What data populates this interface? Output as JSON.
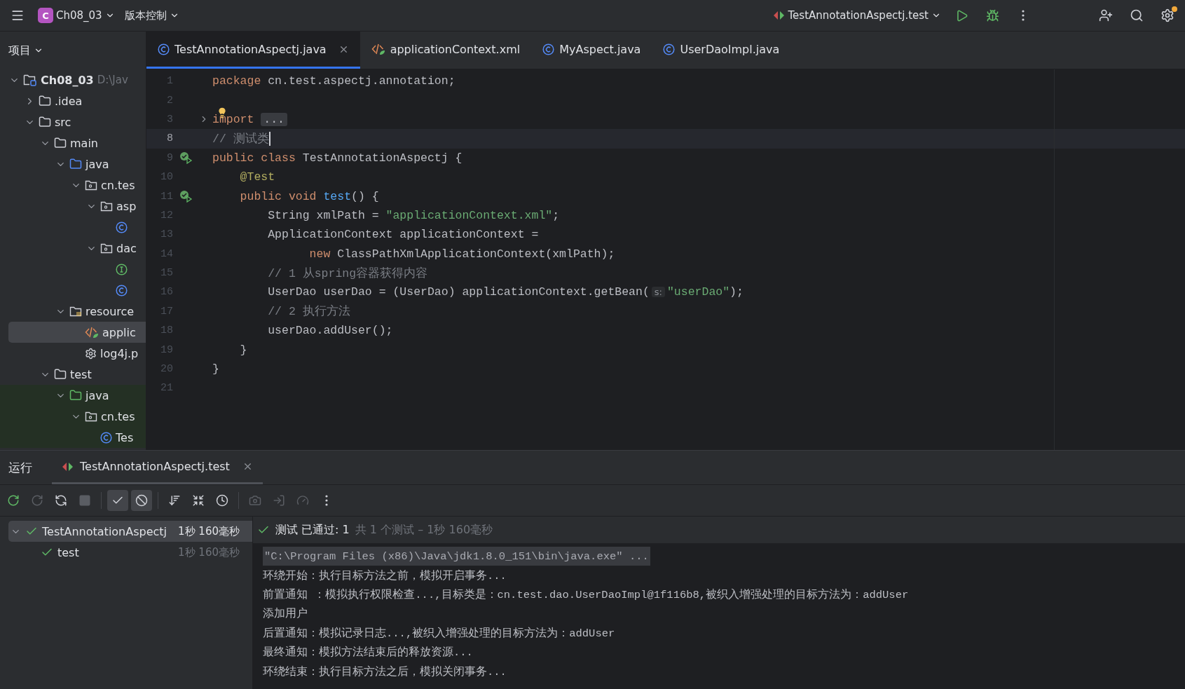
{
  "title_bar": {
    "project_badge": "C",
    "project": "Ch08_03",
    "vcs": "版本控制",
    "run_config": "TestAnnotationAspectj.test",
    "settings_badge": true
  },
  "project_panel": {
    "title": "项目",
    "tree": [
      {
        "label": "Ch08_03",
        "hint": "D:\\Jav",
        "kind": "module",
        "expanded": true,
        "selected": false,
        "test_scope": false,
        "children": [
          {
            "label": ".idea",
            "kind": "folder",
            "expanded": false,
            "selected": false,
            "test_scope": false
          },
          {
            "label": "src",
            "kind": "folder",
            "expanded": true,
            "selected": false,
            "test_scope": false,
            "children": [
              {
                "label": "main",
                "kind": "folder",
                "expanded": true,
                "selected": false,
                "test_scope": false,
                "children": [
                  {
                    "label": "java",
                    "kind": "source",
                    "expanded": true,
                    "selected": false,
                    "test_scope": false,
                    "children": [
                      {
                        "label": "cn.tes",
                        "kind": "package",
                        "expanded": true,
                        "selected": false,
                        "test_scope": false,
                        "children": [
                          {
                            "label": "asp",
                            "kind": "package",
                            "expanded": true,
                            "selected": false,
                            "test_scope": false,
                            "children": [
                              {
                                "kind": "class",
                                "selected": false,
                                "test_scope": false
                              }
                            ]
                          },
                          {
                            "label": "dac",
                            "kind": "package",
                            "expanded": true,
                            "selected": false,
                            "test_scope": false,
                            "children": [
                              {
                                "kind": "interface",
                                "selected": false,
                                "test_scope": false
                              },
                              {
                                "kind": "class",
                                "selected": false,
                                "test_scope": false
                              }
                            ]
                          }
                        ]
                      }
                    ]
                  },
                  {
                    "label": "resource",
                    "kind": "resources",
                    "expanded": true,
                    "selected": false,
                    "test_scope": false,
                    "children": [
                      {
                        "label": "applic",
                        "kind": "xml",
                        "selected": true,
                        "test_scope": false
                      },
                      {
                        "label": "log4j.p",
                        "kind": "settings",
                        "selected": false,
                        "test_scope": false
                      }
                    ]
                  }
                ]
              },
              {
                "label": "test",
                "kind": "folder",
                "expanded": true,
                "selected": false,
                "test_scope": false,
                "children": [
                  {
                    "label": "java",
                    "kind": "test-source",
                    "expanded": true,
                    "selected": false,
                    "test_scope": true,
                    "children": [
                      {
                        "label": "cn.tes",
                        "kind": "package",
                        "expanded": true,
                        "selected": false,
                        "test_scope": true,
                        "children": [
                          {
                            "label": "Tes",
                            "kind": "class",
                            "selected": false,
                            "test_scope": true
                          }
                        ]
                      }
                    ]
                  }
                ]
              }
            ]
          }
        ]
      }
    ]
  },
  "editor_tabs": [
    {
      "label": "TestAnnotationAspectj.java",
      "kind": "class",
      "selected": true,
      "closable": true
    },
    {
      "label": "applicationContext.xml",
      "kind": "xml",
      "selected": false,
      "closable": false
    },
    {
      "label": "MyAspect.java",
      "kind": "class",
      "selected": false,
      "closable": false
    },
    {
      "label": "UserDaoImpl.java",
      "kind": "class",
      "selected": false,
      "closable": false
    }
  ],
  "code": [
    {
      "number": "1",
      "current": false,
      "tokens": [
        {
          "kind": "keyword",
          "text": "package "
        },
        {
          "kind": "plain",
          "text": "cn.test.aspectj.annotation;"
        }
      ]
    },
    {
      "number": "2",
      "current": false
    },
    {
      "number": "3",
      "current": false,
      "folded": true,
      "bulb": true,
      "tokens": [
        {
          "kind": "keyword",
          "text": "import "
        },
        {
          "kind": "fold",
          "text": "..."
        }
      ]
    },
    {
      "number": "8",
      "current": true,
      "tokens": [
        {
          "kind": "comment",
          "text": "// 测试类"
        }
      ]
    },
    {
      "number": "9",
      "current": false,
      "run_marker": true,
      "tokens": [
        {
          "kind": "keyword",
          "text": "public class "
        },
        {
          "kind": "plain",
          "text": "TestAnnotationAspectj {"
        }
      ]
    },
    {
      "number": "10",
      "current": false,
      "tokens": [
        {
          "kind": "annotation",
          "text": "    @Test"
        }
      ]
    },
    {
      "number": "11",
      "current": false,
      "run_marker": true,
      "tokens": [
        {
          "kind": "keyword",
          "text": "    public void "
        },
        {
          "kind": "method",
          "text": "test"
        },
        {
          "kind": "plain",
          "text": "() {"
        }
      ]
    },
    {
      "number": "12",
      "current": false,
      "tokens": [
        {
          "kind": "plain",
          "text": "        String xmlPath = "
        },
        {
          "kind": "string",
          "text": "\"applicationContext.xml\""
        },
        {
          "kind": "plain",
          "text": ";"
        }
      ]
    },
    {
      "number": "13",
      "current": false,
      "tokens": [
        {
          "kind": "plain",
          "text": "        ApplicationContext applicationContext ="
        }
      ]
    },
    {
      "number": "14",
      "current": false,
      "tokens": [
        {
          "kind": "keyword",
          "text": "              new "
        },
        {
          "kind": "plain",
          "text": "ClassPathXmlApplicationContext(xmlPath);"
        }
      ]
    },
    {
      "number": "15",
      "current": false,
      "tokens": [
        {
          "kind": "comment",
          "text": "        // 1 从spring容器获得内容"
        }
      ]
    },
    {
      "number": "16",
      "current": false,
      "tokens": [
        {
          "kind": "plain",
          "text": "        UserDao userDao = (UserDao) applicationContext.getBean("
        },
        {
          "kind": "hint",
          "text": "s:"
        },
        {
          "kind": "string",
          "text": "\"userDao\""
        },
        {
          "kind": "plain",
          "text": ");"
        }
      ]
    },
    {
      "number": "17",
      "current": false,
      "tokens": [
        {
          "kind": "comment",
          "text": "        // 2 执行方法"
        }
      ]
    },
    {
      "number": "18",
      "current": false,
      "tokens": [
        {
          "kind": "plain",
          "text": "        userDao.addUser();"
        }
      ]
    },
    {
      "number": "19",
      "current": false,
      "tokens": [
        {
          "kind": "plain",
          "text": "    }"
        }
      ]
    },
    {
      "number": "20",
      "current": false,
      "tokens": [
        {
          "kind": "plain",
          "text": "}"
        }
      ]
    },
    {
      "number": "21",
      "current": false
    }
  ],
  "run_panel": {
    "title": "运行",
    "tabs": [
      {
        "label": "TestAnnotationAspectj.test",
        "selected": true
      }
    ],
    "toolbar": [
      {
        "kind": "rerun",
        "disabled": false,
        "toggled": false
      },
      {
        "kind": "rerun-failed",
        "disabled": true,
        "toggled": false
      },
      {
        "kind": "auto-test",
        "disabled": false,
        "toggled": false
      },
      {
        "kind": "stop",
        "disabled": true,
        "toggled": false
      },
      {
        "kind": "divider"
      },
      {
        "kind": "show-passed",
        "disabled": false,
        "toggled": true
      },
      {
        "kind": "show-ignored",
        "disabled": false,
        "toggled": true
      },
      {
        "kind": "divider"
      },
      {
        "kind": "sort",
        "disabled": false,
        "toggled": false
      },
      {
        "kind": "collapse",
        "disabled": false,
        "toggled": false
      },
      {
        "kind": "history",
        "disabled": false,
        "toggled": false
      },
      {
        "kind": "divider"
      },
      {
        "kind": "snapshot",
        "disabled": true,
        "toggled": false
      },
      {
        "kind": "import",
        "disabled": true,
        "toggled": false
      },
      {
        "kind": "coverage",
        "disabled": true,
        "toggled": false
      },
      {
        "kind": "more",
        "disabled": false,
        "toggled": false
      }
    ],
    "tests": [
      {
        "name": "TestAnnotationAspectj",
        "time": "1秒 160毫秒",
        "passed": true,
        "expanded": true,
        "selected": true,
        "children": [
          {
            "name": "test",
            "time": "1秒 160毫秒",
            "passed": true,
            "selected": false
          }
        ]
      }
    ],
    "status": {
      "passed": true,
      "label": "测试 已通过: 1",
      "summary": "共 1 个测试 – 1秒 160毫秒"
    },
    "console": [
      {
        "kind": "command",
        "text": "\"C:\\Program Files (x86)\\Java\\jdk1.8.0_151\\bin\\java.exe\" ..."
      },
      {
        "kind": "output",
        "text": "环绕开始：执行目标方法之前，模拟开启事务..."
      },
      {
        "kind": "output",
        "text": "前置通知 ：模拟执行权限检查...,目标类是：cn.test.dao.UserDaoImpl@1f116b8,被织入增强处理的目标方法为：addUser"
      },
      {
        "kind": "output",
        "text": "添加用户"
      },
      {
        "kind": "output",
        "text": "后置通知：模拟记录日志...,被织入增强处理的目标方法为：addUser"
      },
      {
        "kind": "output",
        "text": "最终通知：模拟方法结束后的释放资源..."
      },
      {
        "kind": "output",
        "text": "环绕结束：执行目标方法之后，模拟关闭事务..."
      }
    ]
  }
}
